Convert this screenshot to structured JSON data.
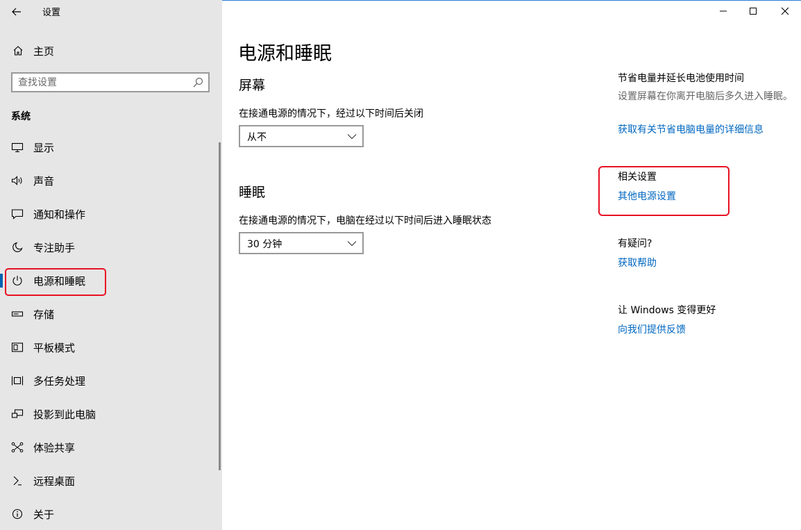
{
  "window": {
    "title": "设置",
    "accent": "#0063b1",
    "link_color": "#0067c0",
    "highlight_color": "#e81123"
  },
  "sidebar": {
    "home_label": "主页",
    "search_placeholder": "查找设置",
    "section_label": "系统",
    "items": [
      {
        "label": "显示",
        "icon": "monitor-icon"
      },
      {
        "label": "声音",
        "icon": "speaker-icon"
      },
      {
        "label": "通知和操作",
        "icon": "notification-icon"
      },
      {
        "label": "专注助手",
        "icon": "moon-icon"
      },
      {
        "label": "电源和睡眠",
        "icon": "power-icon",
        "selected": true
      },
      {
        "label": "存储",
        "icon": "storage-icon"
      },
      {
        "label": "平板模式",
        "icon": "tablet-icon"
      },
      {
        "label": "多任务处理",
        "icon": "multitask-icon"
      },
      {
        "label": "投影到此电脑",
        "icon": "project-icon"
      },
      {
        "label": "体验共享",
        "icon": "share-icon"
      },
      {
        "label": "远程桌面",
        "icon": "remote-desktop-icon"
      },
      {
        "label": "关于",
        "icon": "info-icon"
      }
    ]
  },
  "main": {
    "title": "电源和睡眠",
    "screen": {
      "heading": "屏幕",
      "description": "在接通电源的情况下，经过以下时间后关闭",
      "value": "从不"
    },
    "sleep": {
      "heading": "睡眠",
      "description": "在接通电源的情况下，电脑在经过以下时间后进入睡眠状态",
      "value": "30 分钟"
    }
  },
  "right": {
    "save_power": {
      "heading": "节省电量并延长电池使用时间",
      "text": "设置屏幕在你离开电脑后多久进入睡眠。",
      "link": "获取有关节省电脑电量的详细信息"
    },
    "related": {
      "heading": "相关设置",
      "link": "其他电源设置"
    },
    "question": {
      "heading": "有疑问?",
      "link": "获取帮助"
    },
    "feedback": {
      "heading": "让 Windows 变得更好",
      "link": "向我们提供反馈"
    }
  }
}
